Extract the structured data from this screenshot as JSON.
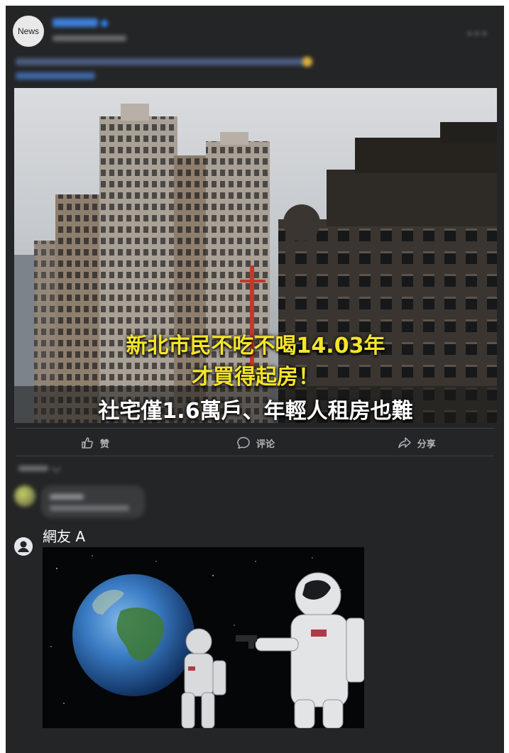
{
  "post": {
    "avatar_text": "News",
    "more_icon": "more-dots-icon"
  },
  "image": {
    "headline_line1": "新北市民不吃不喝14.03年",
    "headline_line2": "才買得起房！",
    "headline_line3": "社宅僅1.6萬戶、年輕人租房也難"
  },
  "actions": {
    "like_label": "赞",
    "comment_label": "评论",
    "share_label": "分享"
  },
  "comment": {
    "author": "網友 A"
  },
  "colors": {
    "card_background": "#242526",
    "headline_yellow": "#f4e52c",
    "action_text": "#b0b3b8"
  }
}
